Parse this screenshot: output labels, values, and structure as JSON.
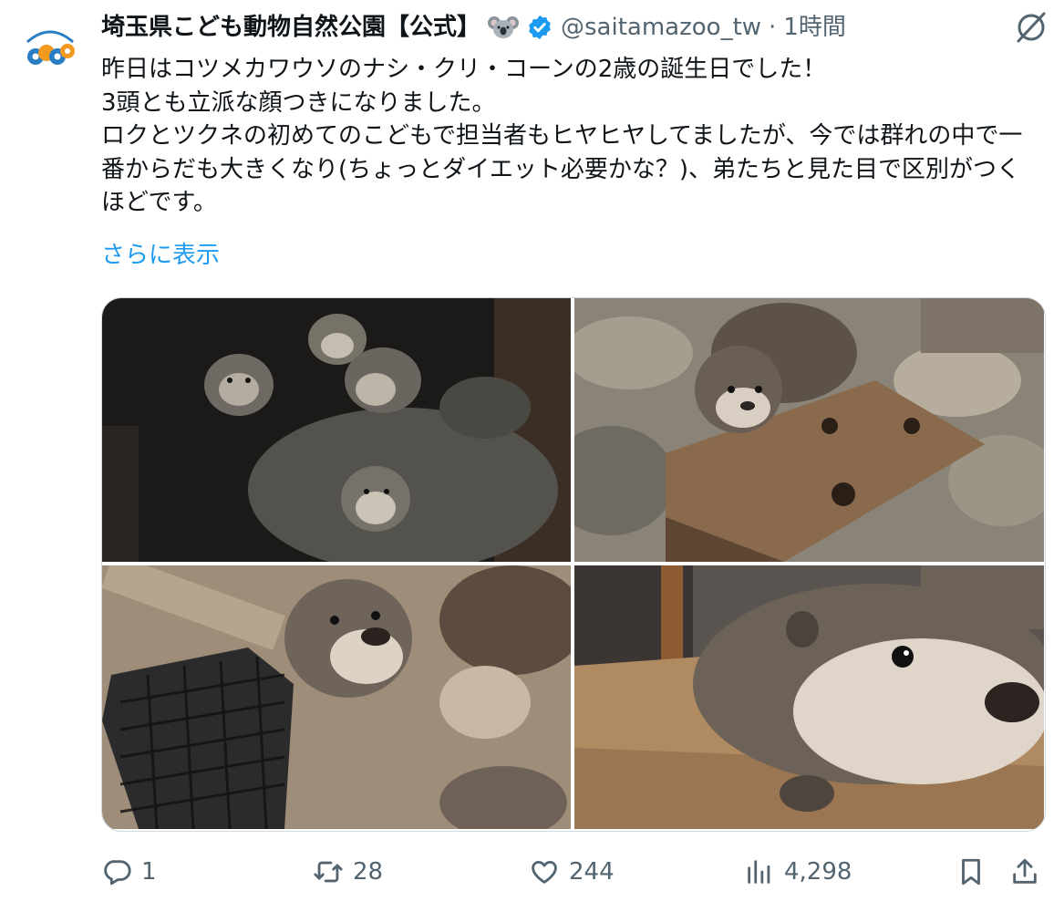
{
  "tweet": {
    "display_name": "埼玉県こども動物自然公園【公式】",
    "handle": "@saitamazoo_tw",
    "separator": "·",
    "time": "1時間",
    "avatar_text": "Saitama Children's Zoo SCZoo",
    "emoji_icon": "koala-emoji-icon",
    "verified_icon": "verified-badge-icon",
    "text_lines": [
      "昨日はコツメカワウソのナシ・クリ・コーンの2歳の誕生日でした！",
      "3頭とも立派な顔つきになりました。",
      "ロクとツクネの初めてのこどもで担当者もヒヤヒヤしてましたが、今では群れの中で一番からだも大きくなり(ちょっとダイエット必要かな？)、弟たちと見た目で区別がつくほどです。"
    ],
    "show_more": "さらに表示"
  },
  "actions": {
    "replies": "1",
    "retweets": "28",
    "likes": "244",
    "views": "4,298"
  },
  "colors": {
    "text": "#0f1419",
    "secondary": "#536471",
    "link": "#1d9bf0",
    "verified": "#1d9bf0",
    "border": "#cfd9de"
  }
}
